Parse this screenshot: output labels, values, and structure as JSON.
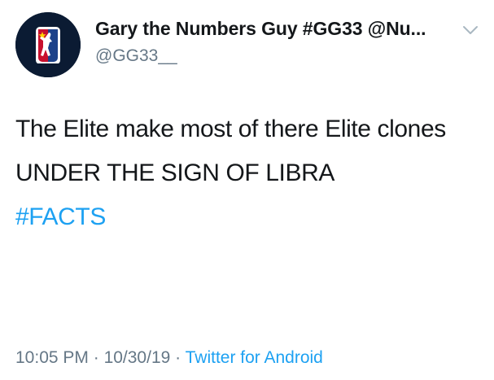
{
  "author": {
    "display_name": "Gary the Numbers Guy #GG33 @Nu...",
    "handle": "@GG33__",
    "avatar_icon": "nba-style-logo-icon"
  },
  "menu_icon": "chevron-down-icon",
  "tweet": {
    "lines": [
      "The Elite make most of there Elite clones",
      "UNDER THE SIGN OF LIBRA"
    ],
    "hashtag": "#FACTS"
  },
  "meta": {
    "time": "10:05 PM",
    "separator1": " · ",
    "date": "10/30/19",
    "separator2": " · ",
    "source": "Twitter for Android"
  },
  "colors": {
    "text": "#14171a",
    "secondary": "#657786",
    "link": "#1da1f2"
  }
}
